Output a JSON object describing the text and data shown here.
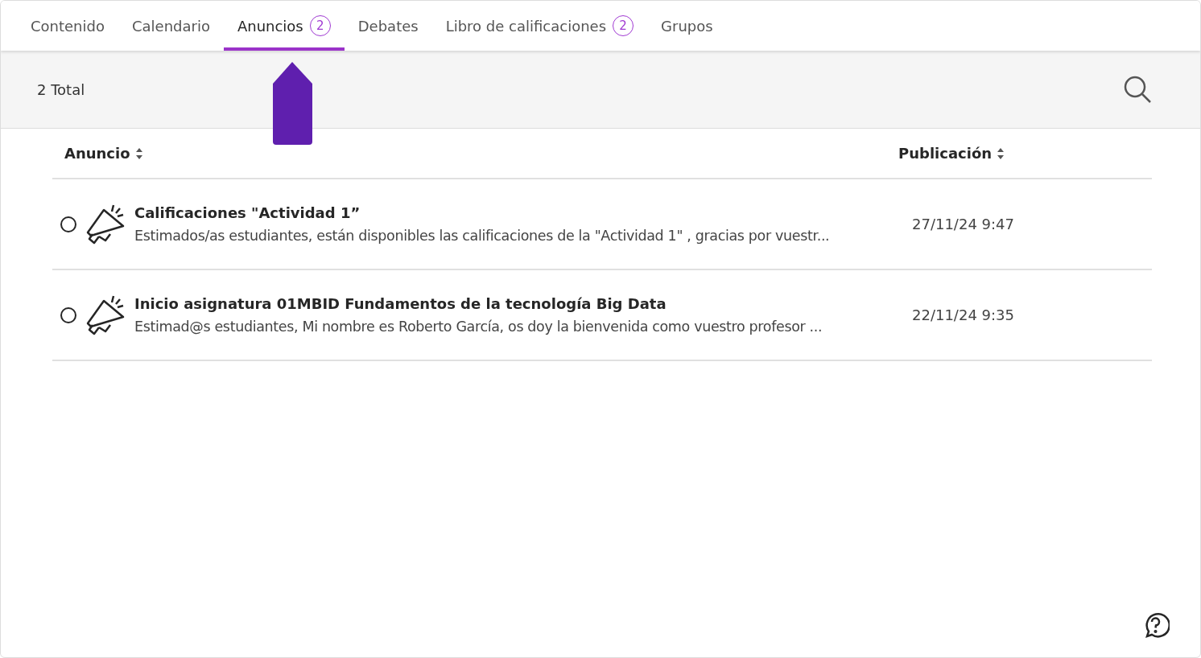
{
  "tabs": [
    {
      "label": "Contenido",
      "selected": false
    },
    {
      "label": "Calendario",
      "selected": false
    },
    {
      "label": "Anuncios",
      "badge": "2",
      "selected": true
    },
    {
      "label": "Debates",
      "selected": false
    },
    {
      "label": "Libro de calificaciones",
      "badge": "2",
      "selected": false
    },
    {
      "label": "Grupos",
      "selected": false
    }
  ],
  "toolbar": {
    "total": "2 Total"
  },
  "table": {
    "columns": [
      "Anuncio",
      "Publicación"
    ],
    "rows": [
      {
        "title": "Calificaciones \"Actividad 1”",
        "preview": "Estimados/as estudiantes, están disponibles las calificaciones de la \"Actividad 1\" , gracias por vuestr...",
        "date": "27/11/24 9:47",
        "selected": false
      },
      {
        "title": "Inicio asignatura 01MBID Fundamentos de la tecnología Big Data",
        "preview": "Estimad@s estudiantes, Mi nombre es Roberto García, os doy la bienvenida como vuestro profesor ...",
        "date": "22/11/24 9:35",
        "selected": false
      }
    ]
  }
}
